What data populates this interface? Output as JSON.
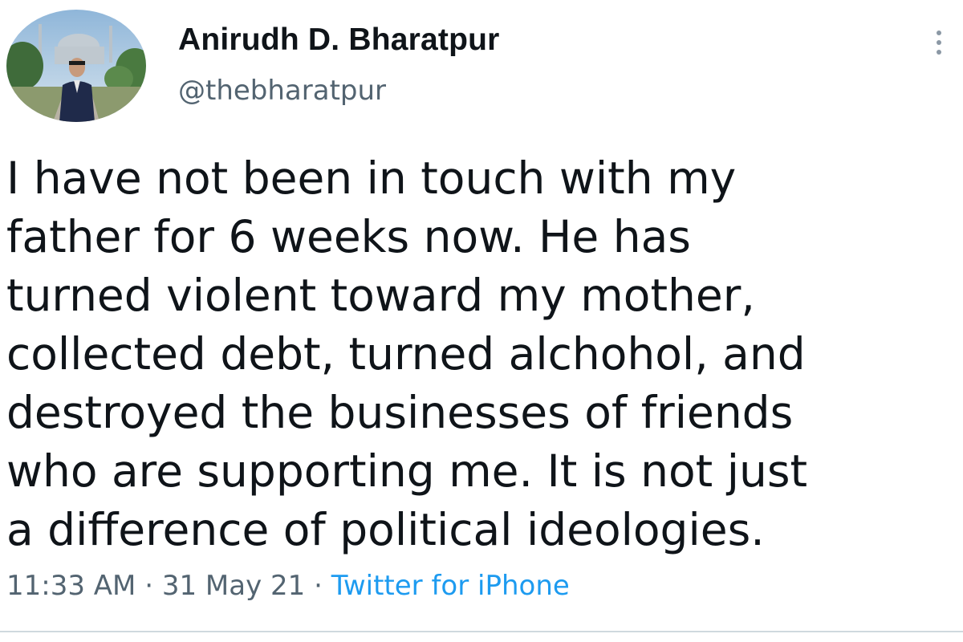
{
  "author": {
    "display_name": "Anirudh D. Bharatpur",
    "handle": "@thebharatpur",
    "avatar_icon": "profile-photo-avatar"
  },
  "tweet": {
    "text_lines": [
      "I have not been in touch with my",
      "father for 6 weeks now. He has",
      "turned violent toward my mother,",
      "collected debt, turned alchohol, and",
      "destroyed the businesses of friends",
      "who are supporting me. It is not just",
      "a difference of political ideologies."
    ]
  },
  "meta": {
    "time": "11:33 AM",
    "separator": "·",
    "date": "31 May 21",
    "source": "Twitter for iPhone"
  },
  "icons": {
    "more": "more-vertical-icon"
  },
  "colors": {
    "text": "#0f1419",
    "secondary": "#536471",
    "link": "#1d9bf0",
    "background": "#ffffff"
  }
}
